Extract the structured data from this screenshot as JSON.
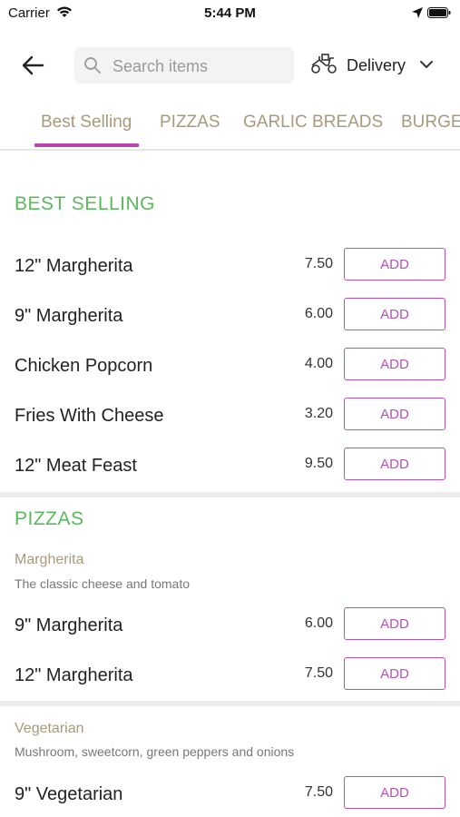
{
  "status": {
    "carrier": "Carrier",
    "time": "5:44 PM"
  },
  "search": {
    "placeholder": "Search items"
  },
  "delivery": {
    "label": "Delivery"
  },
  "tabs": [
    "Best Selling",
    "PIZZAS",
    "GARLIC BREADS",
    "BURGE"
  ],
  "best_selling": {
    "title": "BEST SELLING",
    "items": [
      {
        "name": "12\" Margherita",
        "price": "7.50",
        "add": "ADD"
      },
      {
        "name": "9\" Margherita",
        "price": "6.00",
        "add": "ADD"
      },
      {
        "name": "Chicken Popcorn",
        "price": "4.00",
        "add": "ADD"
      },
      {
        "name": "Fries With Cheese",
        "price": "3.20",
        "add": "ADD"
      },
      {
        "name": "12\" Meat Feast",
        "price": "9.50",
        "add": "ADD"
      }
    ]
  },
  "pizzas": {
    "title": "PIZZAS",
    "groups": [
      {
        "title": "Margherita",
        "description": "The classic cheese and tomato",
        "items": [
          {
            "name": "9\" Margherita",
            "price": "6.00",
            "add": "ADD"
          },
          {
            "name": "12\" Margherita",
            "price": "7.50",
            "add": "ADD"
          }
        ]
      },
      {
        "title": "Vegetarian",
        "description": "Mushroom, sweetcorn, green peppers and onions",
        "items": [
          {
            "name": " 9\" Vegetarian",
            "price": "7.50",
            "add": "ADD"
          }
        ]
      }
    ]
  },
  "colors": {
    "accent": "#b552b5",
    "section": "#5cb85c",
    "muted": "#a89a7a"
  }
}
